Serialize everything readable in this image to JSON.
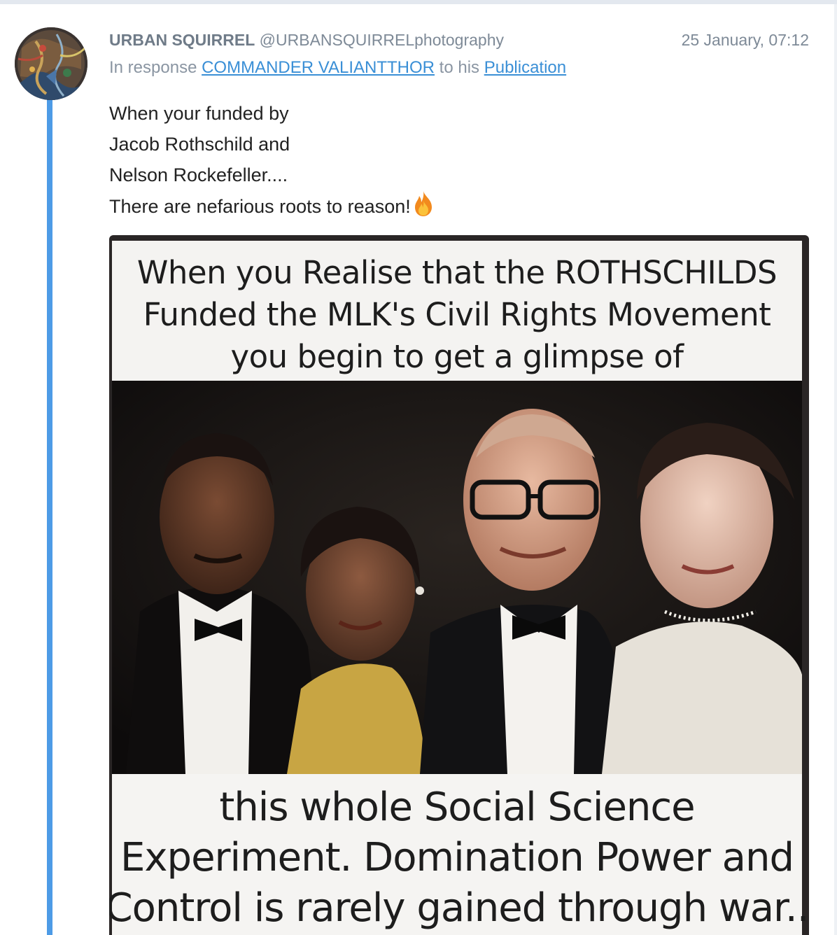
{
  "post": {
    "author_name": "URBAN SQUIRREL",
    "author_handle": "@URBANSQUIRRELphotography",
    "timestamp": "25 January, 07:12",
    "response_prefix": "In response",
    "response_target": "COMMANDER VALIANTTHOR",
    "response_middle": "to his",
    "response_link": "Publication",
    "body_lines": [
      "When your funded by",
      "Jacob Rothschild and",
      "Nelson Rockefeller....",
      "There are nefarious roots to reason!"
    ],
    "emoji_icon": "fire-icon"
  },
  "meme": {
    "top_lines": [
      "When you Realise that the ROTHSCHILDS",
      "Funded the MLK's Civil Rights Movement",
      "you begin to get a glimpse of"
    ],
    "bottom_lines": [
      "this whole Social Science",
      "Experiment. Domination Power and",
      "Control is rarely gained through war.."
    ]
  },
  "colors": {
    "thread_line": "#4d9be6",
    "link": "#3a8fd6",
    "meta_text": "#7e8a97"
  }
}
